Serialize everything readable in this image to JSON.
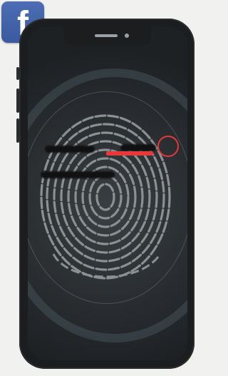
{
  "badge": {
    "letter": "f",
    "brand_color": "#3b5998"
  },
  "scanner": {
    "accent_color": "#e63a3a",
    "icon": "fingerprint-icon"
  }
}
